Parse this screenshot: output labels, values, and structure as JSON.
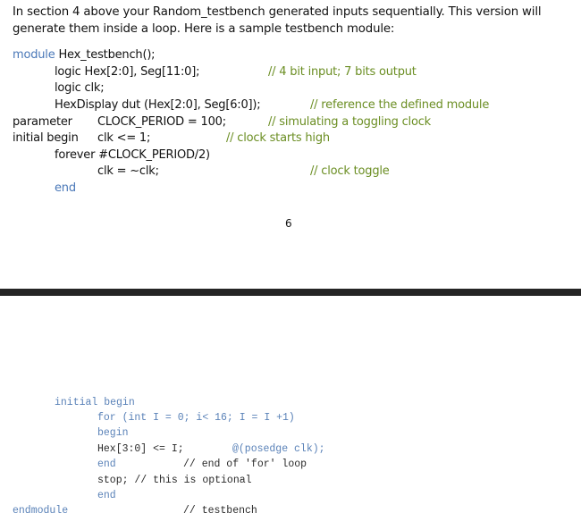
{
  "intro": {
    "line1": "In section 4 above your Random_testbench generated inputs sequentially.  This version will",
    "line2": "generate them inside a loop.  Here is a sample testbench module:"
  },
  "code_top": {
    "l1_kw": "module",
    "l1_rest": " Hex_testbench();",
    "l2_code": "logic Hex[2:0], Seg[11:0];",
    "l2_comment": "// 4 bit input; 7 bits output",
    "l3_code": "logic clk;",
    "l4_code": "HexDisplay dut (Hex[2:0], Seg[6:0]);",
    "l4_comment": "// reference the defined module",
    "l5_kw": "parameter",
    "l5_code": "CLOCK_PERIOD = 100;",
    "l5_comment": "// simulating a toggling clock",
    "l6_kw": "initial begin",
    "l6_code": "clk <= 1;",
    "l6_comment": "// clock starts high",
    "l7_code": "forever #CLOCK_PERIOD/2)",
    "l8_code": "clk = ~clk;",
    "l8_comment": "// clock toggle",
    "l9_kw": "end"
  },
  "page_number": "6",
  "code_bottom": {
    "l1": "initial begin",
    "l2": "for (int I = 0; i< 16; I = I +1)",
    "l3": "begin",
    "l4_code": "Hex[3:0] <= I;",
    "l4_event": "@(posedge clk);",
    "l5_kw": "end",
    "l5_comment": "// end of 'for' loop",
    "l6": "stop; // this is optional",
    "l7": "end",
    "l8_kw": "endmodule",
    "l8_comment": "// testbench"
  }
}
